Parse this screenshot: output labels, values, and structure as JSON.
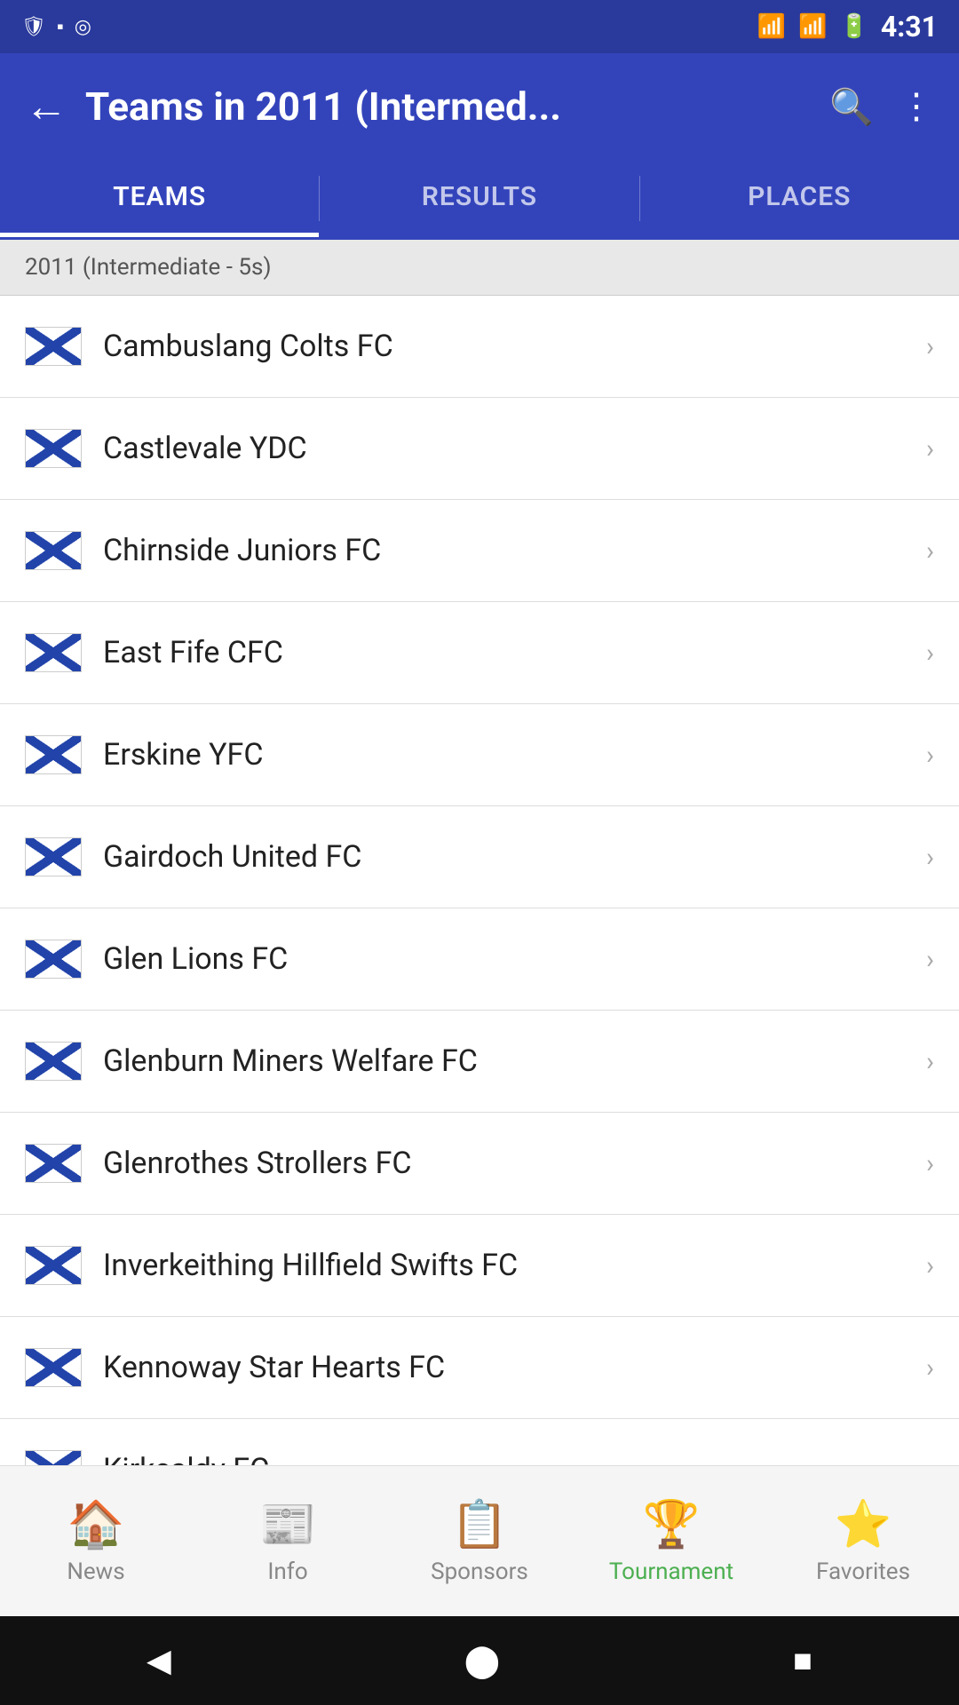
{
  "statusBar": {
    "time": "4:31",
    "icons": [
      "shield",
      "sim",
      "globe"
    ]
  },
  "toolbar": {
    "backLabel": "←",
    "title": "Teams in 2011 (Intermed...",
    "searchIcon": "search",
    "moreIcon": "⋮"
  },
  "tabs": [
    {
      "id": "teams",
      "label": "TEAMS",
      "active": true
    },
    {
      "id": "results",
      "label": "RESULTS",
      "active": false
    },
    {
      "id": "places",
      "label": "PLACES",
      "active": false
    }
  ],
  "sectionHeader": "2011 (Intermediate - 5s)",
  "teams": [
    {
      "name": "Cambuslang Colts FC"
    },
    {
      "name": "Castlevale YDC"
    },
    {
      "name": "Chirnside Juniors FC"
    },
    {
      "name": "East Fife CFC"
    },
    {
      "name": "Erskine YFC"
    },
    {
      "name": "Gairdoch United FC"
    },
    {
      "name": "Glen Lions FC"
    },
    {
      "name": "Glenburn Miners Welfare FC"
    },
    {
      "name": "Glenrothes Strollers FC"
    },
    {
      "name": "Inverkeithing Hillfield Swifts FC"
    },
    {
      "name": "Kennoway Star Hearts FC"
    },
    {
      "name": "Kirkcaldy FC"
    }
  ],
  "bottomNav": [
    {
      "id": "news",
      "label": "News",
      "icon": "🏠",
      "active": false
    },
    {
      "id": "info",
      "label": "Info",
      "icon": "📰",
      "active": false
    },
    {
      "id": "sponsors",
      "label": "Sponsors",
      "icon": "📋",
      "active": false
    },
    {
      "id": "tournament",
      "label": "Tournament",
      "icon": "🏆",
      "active": true
    },
    {
      "id": "favorites",
      "label": "Favorites",
      "icon": "⭐",
      "active": false
    }
  ],
  "systemNav": {
    "back": "◀",
    "home": "⬤",
    "recent": "■"
  }
}
